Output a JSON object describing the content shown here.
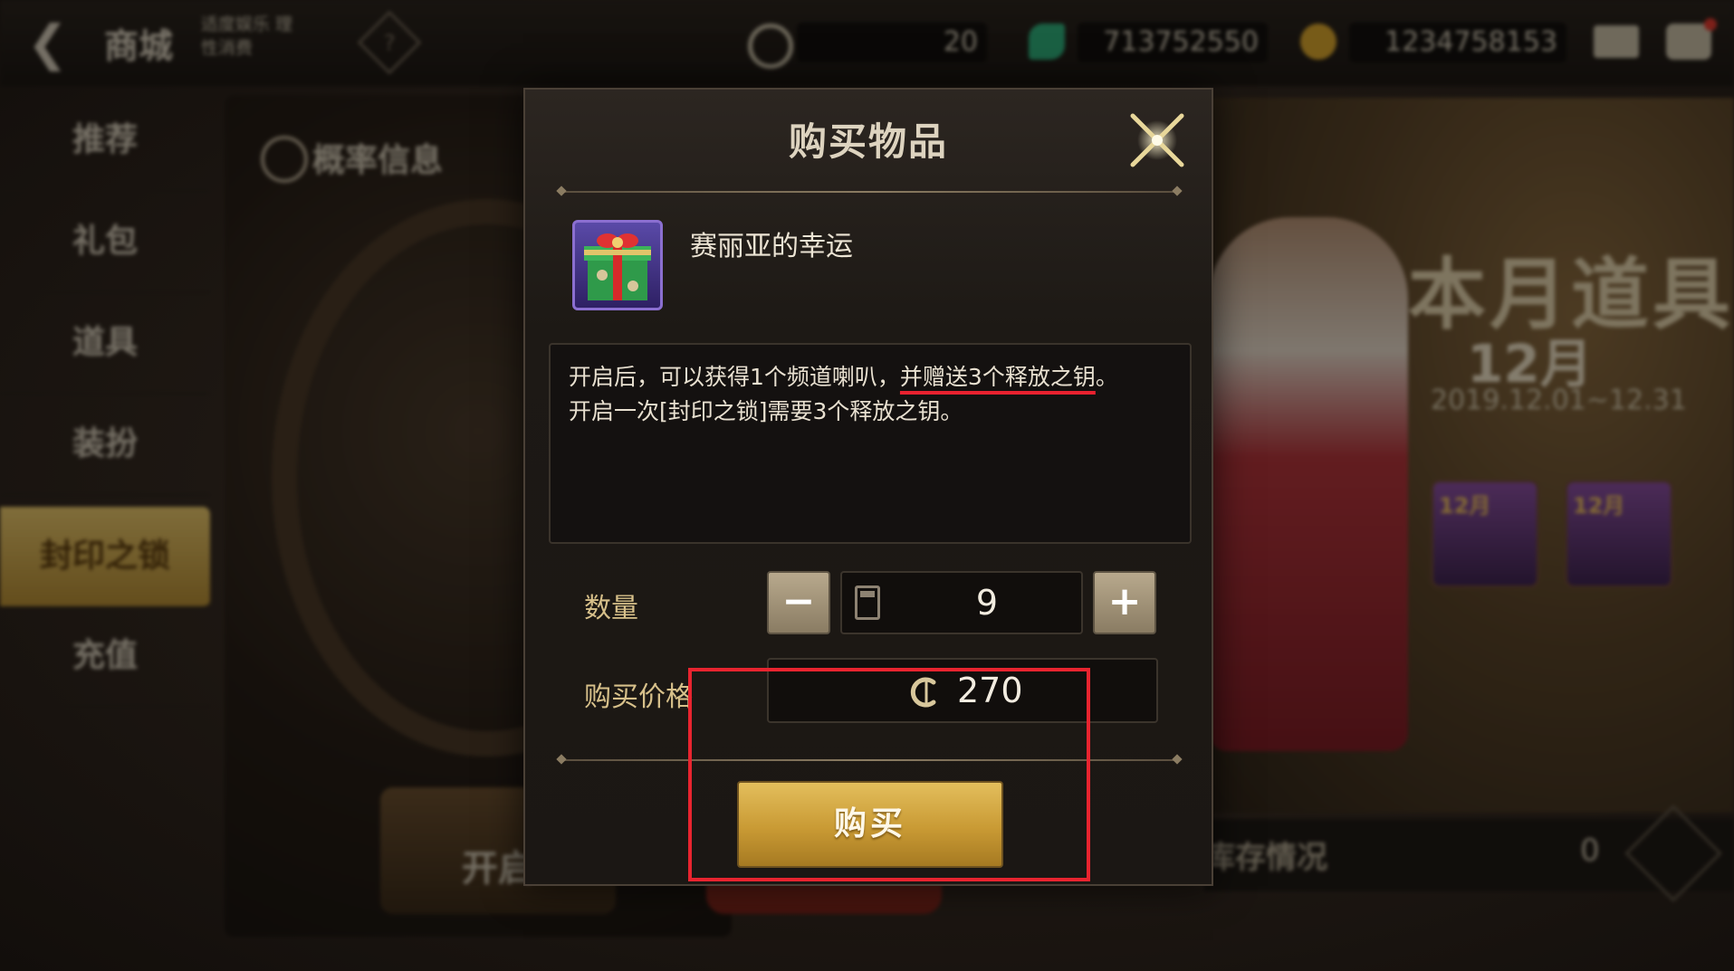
{
  "header": {
    "title": "商城",
    "subtitle": "适度娱乐 理性消费",
    "help_icon": "?",
    "currencies": [
      {
        "icon": "c-coin-icon",
        "value": "20"
      },
      {
        "icon": "green-gem-icon",
        "value": "713752550"
      },
      {
        "icon": "gold-coin-icon",
        "value": "1234758153"
      }
    ],
    "accent": "#e8c66a"
  },
  "sidebar": {
    "items": [
      {
        "label": "推荐"
      },
      {
        "label": "礼包"
      },
      {
        "label": "道具"
      },
      {
        "label": "装扮"
      },
      {
        "label": "封印之锁",
        "active": true
      },
      {
        "label": "充值"
      }
    ]
  },
  "background": {
    "prob_info": "概率信息",
    "open_button": "开启",
    "banner_title": "本月道具",
    "banner_month": "12月",
    "banner_date": "2019.12.01~12.31",
    "banner_items": [
      "12月",
      "12月"
    ],
    "stock_label": "库存情况",
    "stock_count": "0"
  },
  "dialog": {
    "title": "购买物品",
    "item": {
      "name": "赛丽亚的幸运",
      "icon": "gift-box-icon"
    },
    "description": {
      "line1_prefix": "开启后，可以获得1个频道喇叭，",
      "line1_highlight": "并赠送3个释放之钥",
      "line1_suffix": "。",
      "line2": "开启一次[封印之锁]需要3个释放之钥。"
    },
    "quantity_label": "数量",
    "quantity_value": "9",
    "minus_label": "−",
    "plus_label": "+",
    "price_label": "购买价格",
    "price_value": "270",
    "buy_label": "购买",
    "highlight_color": "#e8242f"
  }
}
